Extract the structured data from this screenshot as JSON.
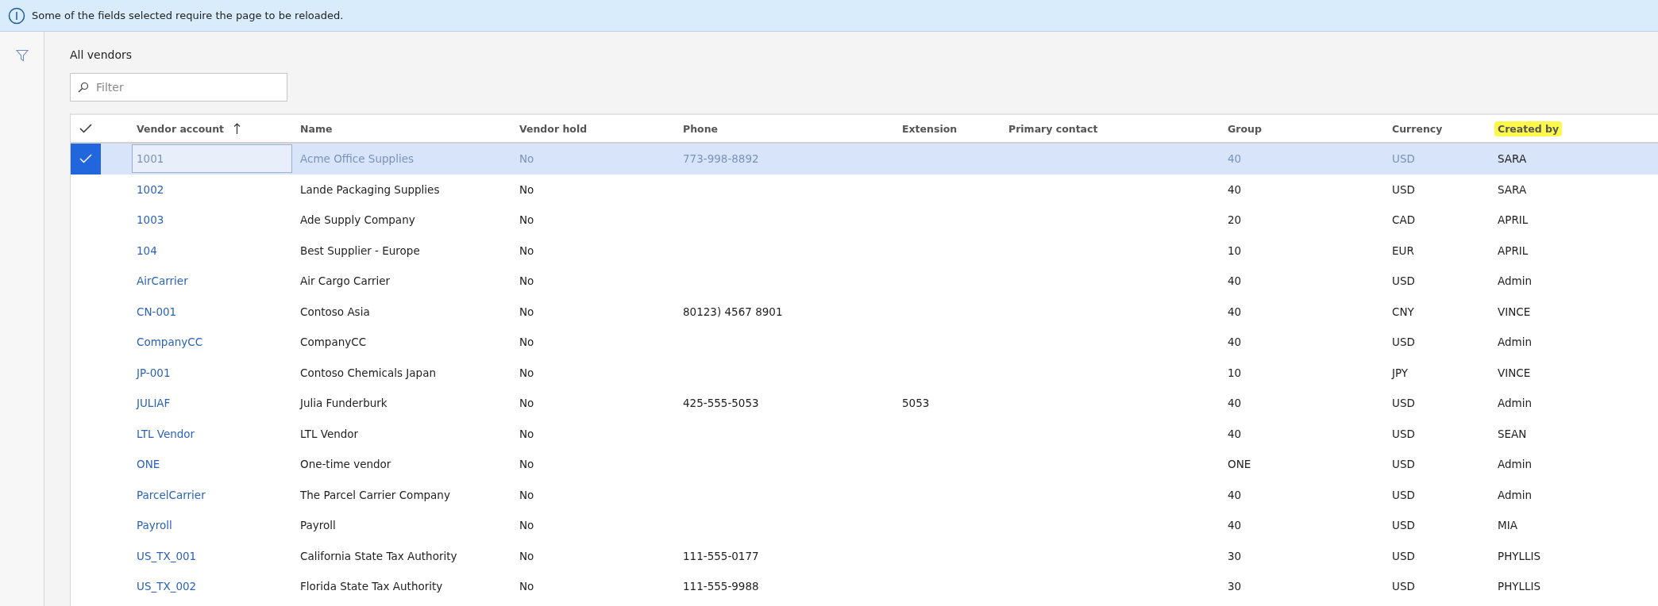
{
  "banner": {
    "message": "Some of the fields selected require the page to be reloaded."
  },
  "page": {
    "title": "All vendors"
  },
  "filter": {
    "placeholder": "Filter"
  },
  "table": {
    "columns": [
      {
        "label": "Vendor account",
        "sorted": true,
        "highlighted": false,
        "kind": "link"
      },
      {
        "label": "Name",
        "sorted": false,
        "highlighted": false
      },
      {
        "label": "Vendor hold",
        "sorted": false,
        "highlighted": false
      },
      {
        "label": "Phone",
        "sorted": false,
        "highlighted": false
      },
      {
        "label": "Extension",
        "sorted": false,
        "highlighted": false
      },
      {
        "label": "Primary contact",
        "sorted": false,
        "highlighted": false
      },
      {
        "label": "Group",
        "sorted": false,
        "highlighted": false
      },
      {
        "label": "Currency",
        "sorted": false,
        "highlighted": false
      },
      {
        "label": "Created by",
        "sorted": false,
        "highlighted": true
      }
    ],
    "rows": [
      {
        "selected": true,
        "cells": [
          "1001",
          "Acme Office Supplies",
          "No",
          "773-998-8892",
          "",
          "",
          "40",
          "USD",
          "SARA"
        ]
      },
      {
        "selected": false,
        "cells": [
          "1002",
          "Lande Packaging Supplies",
          "No",
          "",
          "",
          "",
          "40",
          "USD",
          "SARA"
        ]
      },
      {
        "selected": false,
        "cells": [
          "1003",
          "Ade Supply Company",
          "No",
          "",
          "",
          "",
          "20",
          "CAD",
          "APRIL"
        ]
      },
      {
        "selected": false,
        "cells": [
          "104",
          "Best Supplier - Europe",
          "No",
          "",
          "",
          "",
          "10",
          "EUR",
          "APRIL"
        ]
      },
      {
        "selected": false,
        "cells": [
          "AirCarrier",
          "Air Cargo Carrier",
          "No",
          "",
          "",
          "",
          "40",
          "USD",
          "Admin"
        ]
      },
      {
        "selected": false,
        "cells": [
          "CN-001",
          "Contoso Asia",
          "No",
          "80123) 4567 8901",
          "",
          "",
          "40",
          "CNY",
          "VINCE"
        ]
      },
      {
        "selected": false,
        "cells": [
          "CompanyCC",
          "CompanyCC",
          "No",
          "",
          "",
          "",
          "40",
          "USD",
          "Admin"
        ]
      },
      {
        "selected": false,
        "cells": [
          "JP-001",
          "Contoso Chemicals Japan",
          "No",
          "",
          "",
          "",
          "10",
          "JPY",
          "VINCE"
        ]
      },
      {
        "selected": false,
        "cells": [
          "JULIAF",
          "Julia Funderburk",
          "No",
          "425-555-5053",
          "5053",
          "",
          "40",
          "USD",
          "Admin"
        ]
      },
      {
        "selected": false,
        "cells": [
          "LTL Vendor",
          "LTL Vendor",
          "No",
          "",
          "",
          "",
          "40",
          "USD",
          "SEAN"
        ]
      },
      {
        "selected": false,
        "cells": [
          "ONE",
          "One-time vendor",
          "No",
          "",
          "",
          "",
          "ONE",
          "USD",
          "Admin"
        ]
      },
      {
        "selected": false,
        "cells": [
          "ParcelCarrier",
          "The Parcel Carrier Company",
          "No",
          "",
          "",
          "",
          "40",
          "USD",
          "Admin"
        ]
      },
      {
        "selected": false,
        "cells": [
          "Payroll",
          "Payroll",
          "No",
          "",
          "",
          "",
          "40",
          "USD",
          "MIA"
        ]
      },
      {
        "selected": false,
        "cells": [
          "US_TX_001",
          "California State Tax Authority",
          "No",
          "111-555-0177",
          "",
          "",
          "30",
          "USD",
          "PHYLLIS"
        ]
      },
      {
        "selected": false,
        "cells": [
          "US_TX_002",
          "Florida State Tax Authority",
          "No",
          "111-555-9988",
          "",
          "",
          "30",
          "USD",
          "PHYLLIS"
        ]
      }
    ]
  }
}
